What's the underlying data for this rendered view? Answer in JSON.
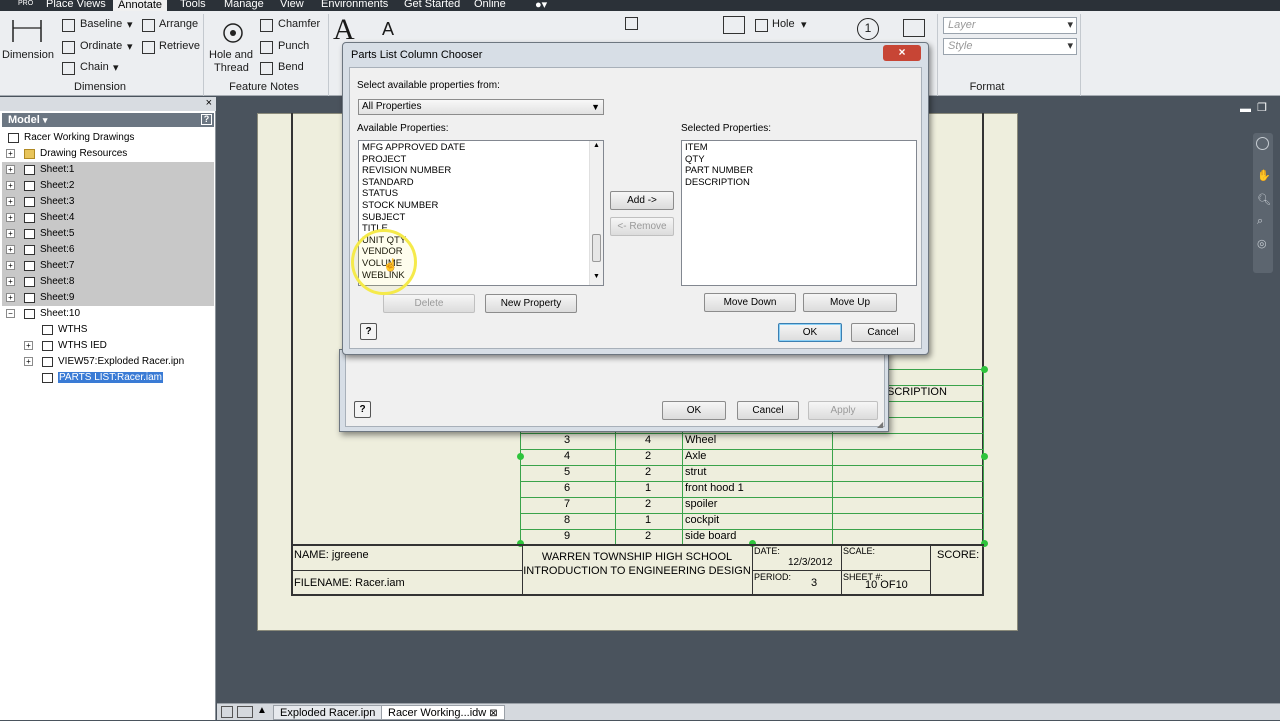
{
  "menubar": {
    "tabs": [
      "Place Views",
      "Annotate",
      "Tools",
      "Manage",
      "View",
      "Environments",
      "Get Started",
      "Online"
    ],
    "active_tab": "Annotate"
  },
  "ribbon": {
    "dimension_label": "Dimension",
    "baseline": "Baseline",
    "arrange": "Arrange",
    "ordinate": "Ordinate",
    "retrieve": "Retrieve",
    "chain": "Chain",
    "dimension_panel": "Dimension",
    "hole_and_thread": "Hole and",
    "hole_and_thread_2": "Thread",
    "chamfer": "Chamfer",
    "punch": "Punch",
    "bend": "Bend",
    "feature_notes_panel": "Feature Notes",
    "hole": "Hole",
    "layer_placeholder": "Layer",
    "style_placeholder": "Style",
    "format_panel": "Format",
    "balloon_number": "1"
  },
  "browser": {
    "header": "Model",
    "items": [
      {
        "label": "Racer Working Drawings",
        "gray": false
      },
      {
        "label": "Drawing Resources",
        "gray": false
      },
      {
        "label": "Sheet:1",
        "gray": true
      },
      {
        "label": "Sheet:2",
        "gray": true
      },
      {
        "label": "Sheet:3",
        "gray": true
      },
      {
        "label": "Sheet:4",
        "gray": true
      },
      {
        "label": "Sheet:5",
        "gray": true
      },
      {
        "label": "Sheet:6",
        "gray": true
      },
      {
        "label": "Sheet:7",
        "gray": true
      },
      {
        "label": "Sheet:8",
        "gray": true
      },
      {
        "label": "Sheet:9",
        "gray": true
      },
      {
        "label": "Sheet:10",
        "gray": false
      },
      {
        "label": "WTHS",
        "gray": false
      },
      {
        "label": "WTHS IED",
        "gray": false
      },
      {
        "label": "VIEW57:Exploded Racer.ipn",
        "gray": false
      },
      {
        "label": "PARTS LIST:Racer.iam",
        "gray": false
      }
    ]
  },
  "parts_list": {
    "header_partial": "SCRIPTION",
    "rows": [
      {
        "item": "3",
        "qty": "4",
        "part": "Wheel"
      },
      {
        "item": "4",
        "qty": "2",
        "part": "Axle"
      },
      {
        "item": "5",
        "qty": "2",
        "part": "strut"
      },
      {
        "item": "6",
        "qty": "1",
        "part": "front hood 1"
      },
      {
        "item": "7",
        "qty": "2",
        "part": "spoiler"
      },
      {
        "item": "8",
        "qty": "1",
        "part": "cockpit"
      },
      {
        "item": "9",
        "qty": "2",
        "part": "side board"
      }
    ]
  },
  "title_block": {
    "name": "NAME: jgreene",
    "filename": "FILENAME: Racer.iam",
    "school": "WARREN TOWNSHIP HIGH SCHOOL",
    "course": "INTRODUCTION TO ENGINEERING DESIGN",
    "date_label": "DATE:",
    "date_value": "12/3/2012",
    "scale_label": "SCALE:",
    "score_label": "SCORE:",
    "period_label": "PERIOD:",
    "period_value": "3",
    "sheet_label": "SHEET #:",
    "sheet_value": "10 OF10"
  },
  "back_dialog": {
    "ok": "OK",
    "cancel": "Cancel",
    "apply": "Apply"
  },
  "chooser": {
    "title": "Parts List Column Chooser",
    "select_from_label": "Select available properties from:",
    "select_value": "All Properties",
    "available_label": "Available Properties:",
    "selected_label": "Selected Properties:",
    "available": [
      "MFG APPROVED DATE",
      "PROJECT",
      "REVISION NUMBER",
      "STANDARD",
      "STATUS",
      "STOCK NUMBER",
      "SUBJECT",
      "TITLE",
      "UNIT QTY",
      "VENDOR",
      "VOLUME",
      "WEBLINK"
    ],
    "selected": [
      "ITEM",
      "QTY",
      "PART NUMBER",
      "DESCRIPTION"
    ],
    "add": "Add ->",
    "remove": "<- Remove",
    "delete": "Delete",
    "new_property": "New Property",
    "move_down": "Move Down",
    "move_up": "Move Up",
    "ok": "OK",
    "cancel": "Cancel"
  },
  "statusbar": {
    "tab1": "Exploded Racer.ipn",
    "tab2": "Racer Working...idw"
  }
}
